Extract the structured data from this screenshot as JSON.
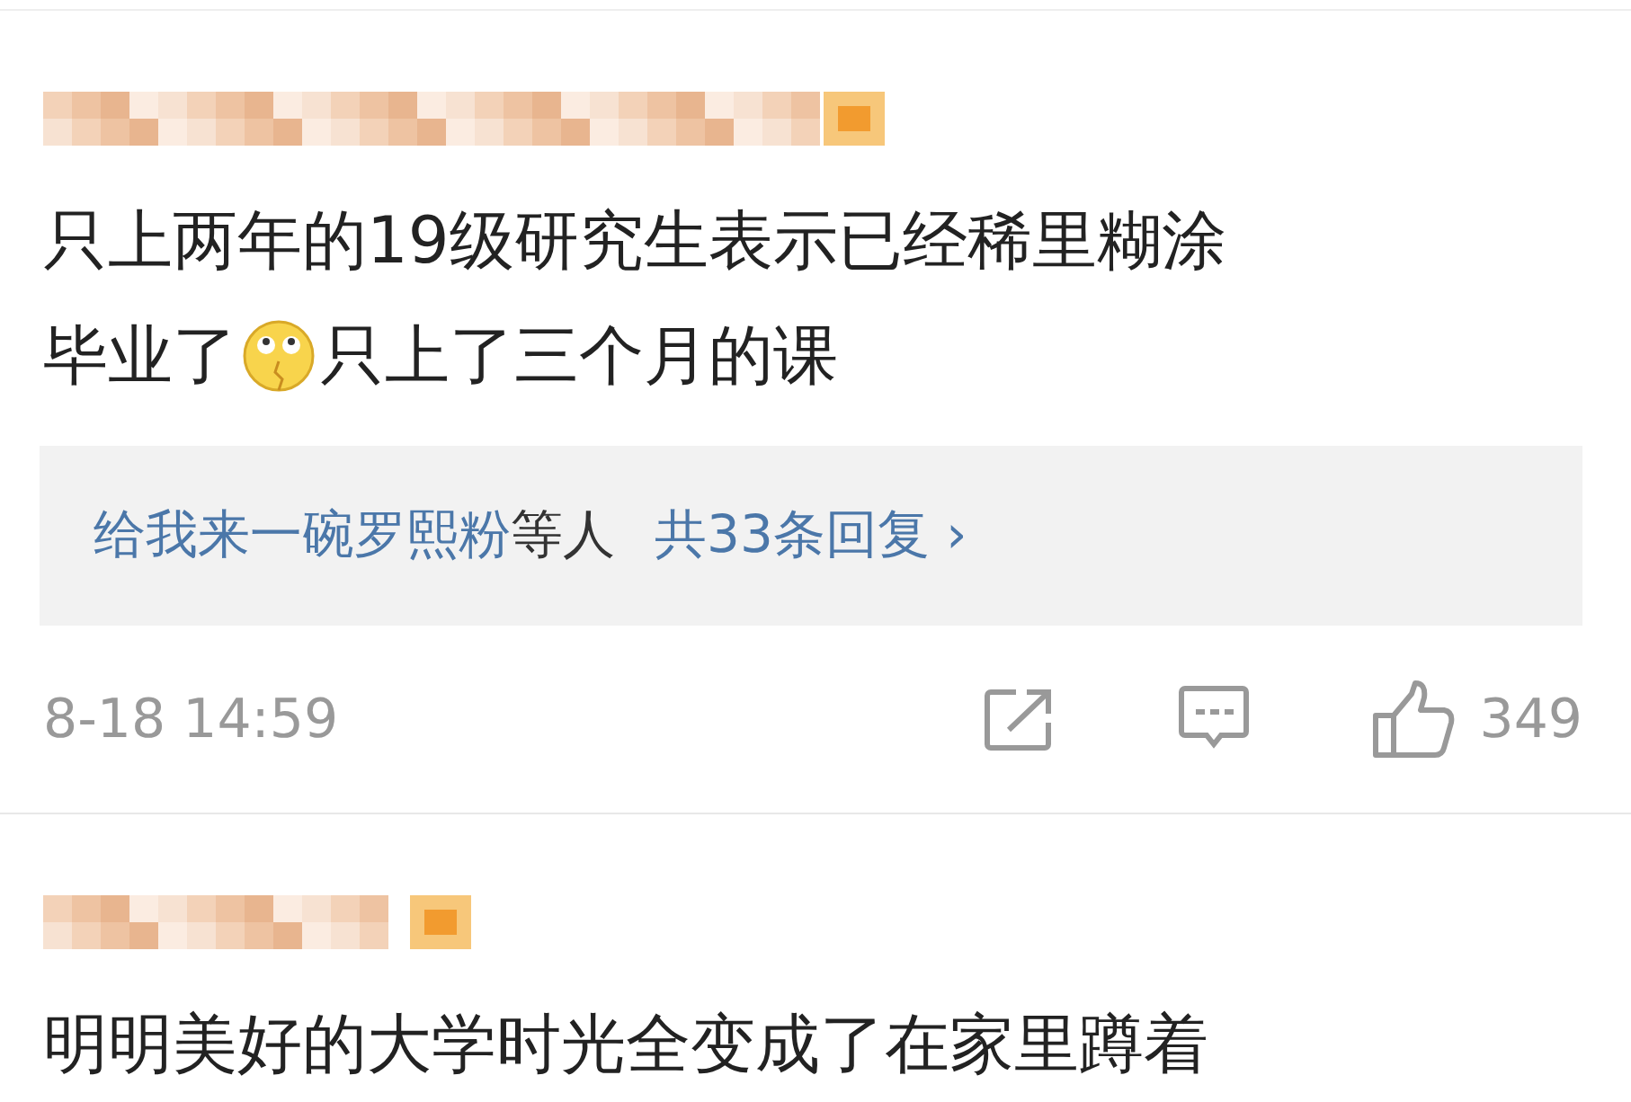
{
  "comments": [
    {
      "lines": [
        [
          {
            "kind": "text",
            "text": "只上两年的19级研究生表示已经稀里糊涂"
          }
        ],
        [
          {
            "kind": "text",
            "text": "毕业了"
          },
          {
            "kind": "emoji"
          },
          {
            "kind": "text",
            "text": "只上了三个月的课"
          }
        ]
      ],
      "replies": {
        "user": "给我来一碗罗熙粉",
        "suffix": "等人",
        "count": "共33条回复",
        "arrow": "›"
      },
      "time": "8-18 14:59",
      "likes": "349"
    },
    {
      "lines": [
        [
          {
            "kind": "text",
            "text": "明明美好的大学时光全变成了在家里蹲着"
          }
        ]
      ]
    }
  ]
}
